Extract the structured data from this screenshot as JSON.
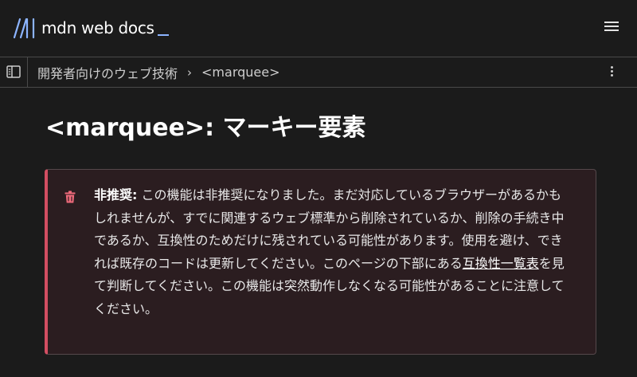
{
  "header": {
    "logo_text": "mdn web docs",
    "menu_icon": "hamburger-menu-icon"
  },
  "breadcrumb": {
    "section": "開発者向けのウェブ技術",
    "separator": "›",
    "current": "<marquee>",
    "sidebar_icon": "sidebar-toggle-icon",
    "more_icon": "more-vertical-icon"
  },
  "page": {
    "title": "<marquee>: マーキー要素"
  },
  "deprecation_notice": {
    "icon": "trash-icon",
    "label": "非推奨:",
    "text_before_link": " この機能は非推奨になりました。まだ対応しているブラウザーがあるかもしれませんが、すでに関連するウェブ標準から削除されているか、削除の手続き中であるか、互換性のためだけに残されている可能性があります。使用を避け、できれば既存のコードは更新してください。このページの下部にある",
    "link_text": "互換性一覧表",
    "text_after_link": "を見て判断してください。この機能は突然動作しなくなる可能性があることに注意してください。"
  },
  "colors": {
    "background": "#1b1b1b",
    "accent_blue": "#8cb4ff",
    "notice_border": "#d24e62",
    "notice_background": "#2b1d20",
    "trash_icon": "#f06b7c"
  }
}
